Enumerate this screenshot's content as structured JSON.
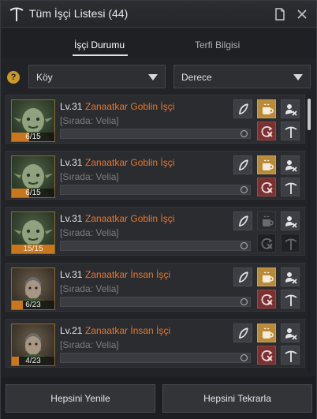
{
  "window": {
    "title": "Tüm İşçi Listesi (44)",
    "icons": [
      "worker-pick-icon",
      "document-icon",
      "close-icon"
    ]
  },
  "tabs": [
    {
      "label": "İşçi Durumu",
      "active": true
    },
    {
      "label": "Terfi Bilgisi",
      "active": false
    }
  ],
  "filters": {
    "help_label": "?",
    "village": {
      "value": "Köy"
    },
    "grade": {
      "value": "Derece"
    }
  },
  "workers": [
    {
      "level": "Lv.31",
      "name": "Zanaatkar Goblin İşçi",
      "status": "[Sırada: Velia]",
      "stamina": "6/15",
      "stamina_fraction": 0.4,
      "portrait": "goblin",
      "pot_active": true,
      "dimmed": false
    },
    {
      "level": "Lv.31",
      "name": "Zanaatkar Goblin İşçi",
      "status": "[Sırada: Velia]",
      "stamina": "6/15",
      "stamina_fraction": 0.4,
      "portrait": "goblin",
      "pot_active": true,
      "dimmed": false
    },
    {
      "level": "Lv.31",
      "name": "Zanaatkar Goblin İşçi",
      "status": "[Sırada: Velia]",
      "stamina": "15/15",
      "stamina_fraction": 1.0,
      "portrait": "goblin",
      "pot_active": false,
      "dimmed": true
    },
    {
      "level": "Lv.31",
      "name": "Zanaatkar İnsan İşçi",
      "status": "[Sırada: Velia]",
      "stamina": "6/23",
      "stamina_fraction": 0.26,
      "portrait": "human",
      "pot_active": true,
      "dimmed": false
    },
    {
      "level": "Lv.21",
      "name": "Zanaatkar İnsan İşçi",
      "status": "[Sırada: Velia]",
      "stamina": "4/23",
      "stamina_fraction": 0.17,
      "portrait": "human",
      "pot_active": true,
      "dimmed": false
    }
  ],
  "footer": {
    "refresh_all": "Hepsini Yenile",
    "repeat_all": "Hepsini Tekrarla"
  },
  "colors": {
    "worker_name": "#e8762b",
    "stamina_fill": "#c9771e",
    "gold_button": "#b88a3a",
    "red_button": "#7a3131"
  }
}
